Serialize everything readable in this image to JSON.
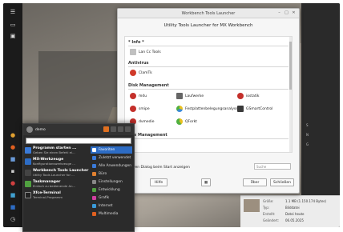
{
  "dialog": {
    "window_title": "Workbench Tools Launcher",
    "subtitle": "Utility Tools Launcher for MX Workbench",
    "sections": [
      {
        "name": "* Info *",
        "tools": [
          "Lan Cc Tools"
        ]
      },
      {
        "name": "Antivirus",
        "tools": [
          "ClamTk"
        ]
      },
      {
        "name": "Disk Management",
        "tools": [
          "mdu",
          "Laufwerke",
          "iostatik",
          "smipe",
          "Festplattenbelegungsanalyse",
          "GSmartControl",
          "dvmedie",
          "QForkt"
        ]
      },
      {
        "name": "File Management",
        "tools": []
      }
    ],
    "checkbox_label": "Den Dialog beim Start anzeigen",
    "search_placeholder": "Suche",
    "buttons": {
      "help": "Hilfe",
      "about": "Über",
      "close": "Schließen",
      "icon": "▦"
    }
  },
  "startmenu": {
    "username": "demo",
    "favorites": [
      {
        "title": "Programm starten ...",
        "desc": "Geben Sie einen Befehl ei..."
      },
      {
        "title": "MX-Werkzeuge",
        "desc": "Konfigurationswerkzeuge ..."
      },
      {
        "title": "Workbench Tools Launcher",
        "desc": "Utility Tools Launcher for ..."
      },
      {
        "title": "Taskmanager",
        "desc": "Einfach zu bedienende An..."
      },
      {
        "title": "Xfce-Terminal",
        "desc": "Terminal-Programm"
      }
    ],
    "categories": [
      "Favoriten",
      "Zuletzt verwendet",
      "Alle Anwendungen",
      "Büro",
      "Einstellungen",
      "Entwicklung",
      "Grafik",
      "Internet",
      "Multimedia"
    ]
  },
  "filemanager": {
    "size_value": "1.1 MB (1.150.174 Bytes)",
    "labels": [
      "Größe:",
      "Typ:",
      "Erstellt:",
      "Geändert:"
    ],
    "values": [
      "",
      "Bilddatei",
      "Datei heute",
      "06.05.2025"
    ]
  },
  "right_panel": {
    "items": [
      "S",
      "N",
      "G"
    ]
  }
}
